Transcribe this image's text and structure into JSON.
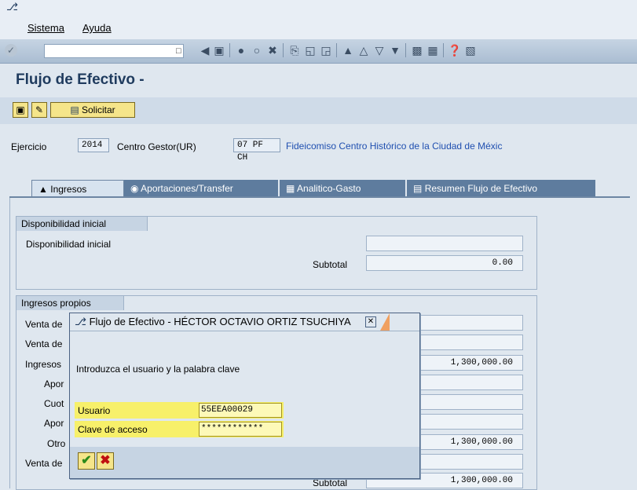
{
  "menu": {
    "sistema": "Sistema",
    "ayuda": "Ayuda"
  },
  "page_title": "Flujo de Efectivo -",
  "app_toolbar": {
    "solicitar": "Solicitar"
  },
  "header": {
    "ejercicio_label": "Ejercicio",
    "ejercicio_value": "2014",
    "centro_label": "Centro Gestor(UR)",
    "centro_value": "07 PF CH",
    "centro_name": "Fideicomiso Centro Histórico de la Ciudad de Méxic"
  },
  "tabs": [
    {
      "label": "Ingresos",
      "icon": "bell-icon"
    },
    {
      "label": "Aportaciones/Transfer",
      "icon": "coin-icon"
    },
    {
      "label": "Analitico-Gasto",
      "icon": "chart-icon"
    },
    {
      "label": "Resumen Flujo de Efectivo",
      "icon": "document-icon"
    }
  ],
  "groups": {
    "disponibilidad": {
      "title": "Disponibilidad inicial",
      "row_label": "Disponibilidad inicial",
      "subtotal_label": "Subtotal",
      "subtotal_value": "0.00"
    },
    "ingresos": {
      "title": "Ingresos propios",
      "rows": [
        "Venta de",
        "Venta de",
        "Ingresos",
        "Apor",
        "Cuot",
        "Apor",
        "Otro",
        "Venta de"
      ],
      "values": [
        "",
        "",
        "1,300,000.00",
        "",
        "",
        "",
        "1,300,000.00",
        ""
      ],
      "subtotal_label": "Subtotal",
      "subtotal_value": "1,300,000.00"
    }
  },
  "dialog": {
    "title": "Flujo de Efectivo - HÉCTOR OCTAVIO ORTIZ TSUCHIYA",
    "message": "Introduzca el usuario y la palabra clave",
    "usuario_label": "Usuario",
    "usuario_value": "55EEA00029",
    "clave_label": "Clave de acceso",
    "clave_value": "************"
  },
  "colors": {
    "accent": "#1f3b5e",
    "highlight": "#f7f06a",
    "link": "#1f4fb0"
  }
}
